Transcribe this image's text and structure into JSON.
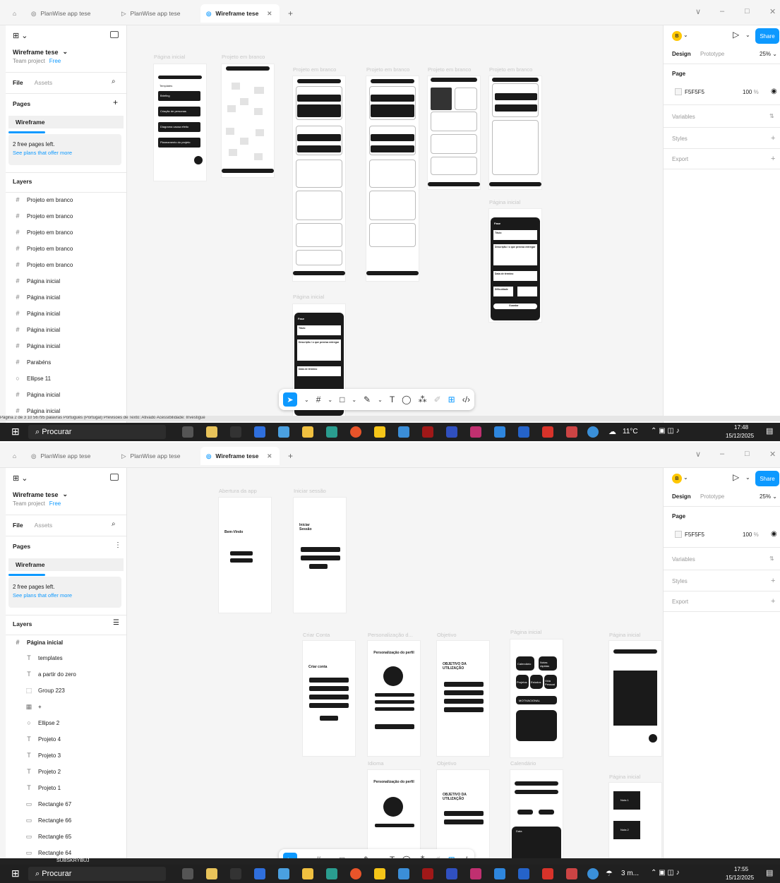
{
  "tabs": {
    "home_icon": "home-icon",
    "tab1": "PlanWise app tese",
    "tab2": "PlanWise app tese",
    "tab3": "Wireframe tese",
    "add": "+"
  },
  "window": {
    "min": "–",
    "max": "□",
    "close": "✕",
    "menu": "∨"
  },
  "left": {
    "file_name": "Wireframe tese",
    "team_label": "Team project",
    "free_badge": "Free",
    "file_tab": "File",
    "assets_tab": "Assets",
    "pages_label": "Pages",
    "page_item": "Wireframe",
    "free_pages": "2 free pages left.",
    "see_plans": "See plans that offer more",
    "layers_label": "Layers"
  },
  "layers1": [
    "Projeto em branco",
    "Projeto em branco",
    "Projeto em branco",
    "Projeto em branco",
    "Projeto em branco",
    "Página inicial",
    "Página inicial",
    "Página inicial",
    "Página inicial",
    "Página inicial",
    "Parabéns",
    "Ellipse 11",
    "Página inicial",
    "Página inicial"
  ],
  "layers2": {
    "root": "Página inicial",
    "children": [
      "templates",
      "a partir do zero",
      "Group 223",
      "+",
      "Ellipse 2",
      "Projeto 4",
      "Projeto 3",
      "Projeto 2",
      "Projeto 1",
      "Rectangle 67",
      "Rectangle 66",
      "Rectangle 65",
      "Rectangle 64"
    ]
  },
  "right": {
    "avatar": "B",
    "share": "Share",
    "design_tab": "Design",
    "prototype_tab": "Prototype",
    "zoom": "25%",
    "page_label": "Page",
    "page_color": "F5F5F5",
    "opacity": "100",
    "opacity_unit": "%",
    "variables": "Variables",
    "styles": "Styles",
    "export": "Export"
  },
  "canvas1": {
    "labels": [
      "Página inicial",
      "Projeto em branco",
      "Projeto em branco",
      "Projeto em branco",
      "Projeto em branco",
      "Projeto em branco",
      "Página inicial",
      "Página inicial"
    ],
    "menu_items": [
      "Templates",
      "Briefing",
      "Criação de personas",
      "Diagrama causa efeito",
      "Planeamento do projeto"
    ],
    "fase": "Fase",
    "titulo": "Título",
    "desc": "Descrição / o que precisa entregar",
    "data": "Data de término",
    "dif": "Dificuldade",
    "guardar": "Guardar"
  },
  "canvas2": {
    "labels": [
      "Abertura da app",
      "Iniciar sessão",
      "Criar Conta",
      "Personalização d...",
      "Objetivo",
      "Página inicial",
      "Página inicial",
      "Idioma",
      "Objetivo",
      "Calendário",
      "Página inicial"
    ],
    "bem_vindo": "Bem-Vindo",
    "iniciar_sessao": "Iniciar Sessão",
    "criar_conta": "Criar conta",
    "personalizacao": "Personalização do perfil",
    "objetivo": "OBJETIVO DA UTILIZAÇÃO",
    "cal": "Calendário",
    "notas": "Notas rápidas",
    "projetos": "Projetos",
    "estudos": "Estudos",
    "vida": "Vida Pessoal",
    "motivacao": "MOTIVACIONAL",
    "nota1": "Nota 1",
    "nota2": "Nota 2",
    "data": "Data"
  },
  "taskbar": {
    "search": "Procurar",
    "temp": "11°C",
    "weather": "3 m...",
    "time1": "17:48",
    "date1": "15/12/2025",
    "time2": "17:55",
    "date2": "15/12/2025"
  },
  "status1": "Página 2 de 3 10    56795 palavras    Português (Portugal)    Previsões de Texto: Ativado    Acessibilidade: Investigue",
  "status2": "SUBSKRYBUJ",
  "help": "?"
}
